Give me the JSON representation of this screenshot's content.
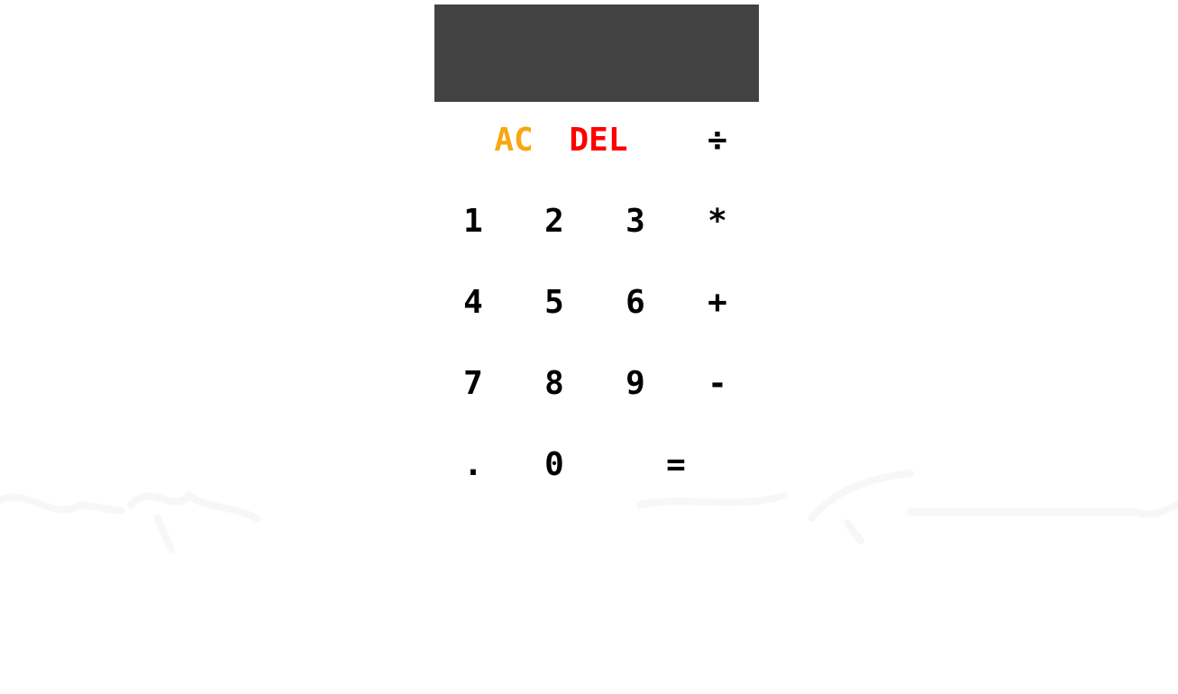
{
  "display": {
    "value": ""
  },
  "keypad": {
    "ac": "AC",
    "del": "DEL",
    "divide": "÷",
    "multiply": "*",
    "add": "+",
    "subtract": "-",
    "decimal": ".",
    "equals": "=",
    "digits": {
      "d0": "0",
      "d1": "1",
      "d2": "2",
      "d3": "3",
      "d4": "4",
      "d5": "5",
      "d6": "6",
      "d7": "7",
      "d8": "8",
      "d9": "9"
    }
  },
  "colors": {
    "display_bg": "#424242",
    "ac": "#f7a712",
    "del": "#ff0000",
    "key_text": "#000000",
    "page_bg": "#ffffff"
  }
}
